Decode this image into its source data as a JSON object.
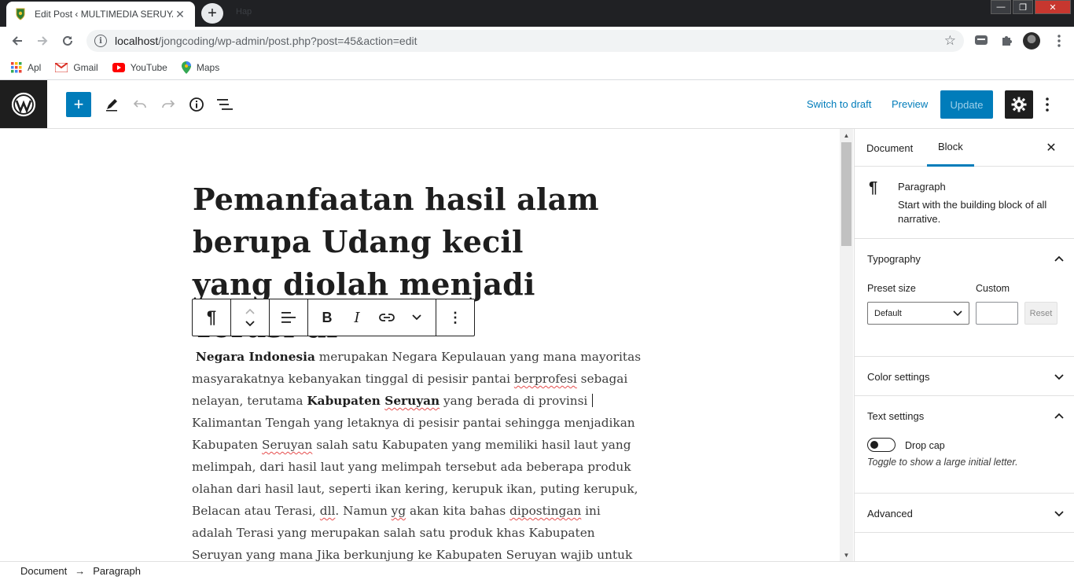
{
  "browser": {
    "tab_title": "Edit Post ‹ MULTIMEDIA SERUYAN",
    "tab_close": "✕",
    "new_tab": "+",
    "ghost_tab": "Hap",
    "url_host": "localhost",
    "url_path": "/jongcoding/wp-admin/post.php?post=45&action=edit",
    "win_min": "—",
    "win_max": "❐",
    "win_close": "✕",
    "bookmarks": [
      {
        "label": "Apl",
        "icon": "apps-grid-icon"
      },
      {
        "label": "Gmail",
        "icon": "gmail-icon"
      },
      {
        "label": "YouTube",
        "icon": "youtube-icon"
      },
      {
        "label": "Maps",
        "icon": "maps-pin-icon"
      }
    ]
  },
  "header": {
    "switch_to_draft": "Switch to draft",
    "preview": "Preview",
    "update": "Update",
    "add_symbol": "+"
  },
  "post": {
    "title": "Pemanfaatan hasil alam berupa Udang kecil yang diolah menjadi Terasi di",
    "paragraph": {
      "lead_bold": "Negara Indonesia",
      "t1": " merupakan Negara Kepulauan yang mana mayoritas masyarakatnya kebanyakan tinggal di pesisir pantai ",
      "w_berprofesi": "berprofesi",
      "t2": " sebagai nelayan, terutama ",
      "bold_kab": "Kabupaten ",
      "bold_seruyan": "Seruyan",
      "t3": " yang berada di provinsi",
      "t4": " Kalimantan Tengah yang letaknya di pesisir pantai sehingga menjadikan Kabupaten ",
      "w_seruyan1": "Seruyan",
      "t5": " salah satu Kabupaten yang memiliki hasil laut yang melimpah, dari hasil laut yang melimpah tersebut ada beberapa produk olahan dari hasil laut, seperti ikan kering, kerupuk ikan, puting kerupuk, Belacan atau Terasi, ",
      "w_dll": "dll",
      "t6": ". Namun ",
      "w_yg": "yg",
      "t7": " akan kita bahas ",
      "w_dipostingan": "dipostingan",
      "t8": " ini adalah Terasi yang merupakan salah satu produk khas Kabupaten ",
      "w_seruyan2": "Seruyan",
      "t9": " yang mana Jika berkunjung ke Kabupaten ",
      "w_seruyan3": "Seruyan",
      "t10": " wajib untuk membeli terasi"
    }
  },
  "block_toolbar": {
    "paragraph_symbol": "¶",
    "bold": "B",
    "italic": "I",
    "more": "⋮"
  },
  "sidebar": {
    "tab_document": "Document",
    "tab_block": "Block",
    "close": "✕",
    "block_name": "Paragraph",
    "block_description": "Start with the building block of all narrative.",
    "block_icon_symbol": "¶",
    "typography": {
      "title": "Typography",
      "preset_label": "Preset size",
      "custom_label": "Custom",
      "preset_value": "Default",
      "reset": "Reset"
    },
    "color_settings": "Color settings",
    "text_settings": {
      "title": "Text settings",
      "drop_cap": "Drop cap",
      "help": "Toggle to show a large initial letter."
    },
    "advanced": "Advanced"
  },
  "footer": {
    "crumb_document": "Document",
    "arrow": "→",
    "crumb_paragraph": "Paragraph"
  }
}
